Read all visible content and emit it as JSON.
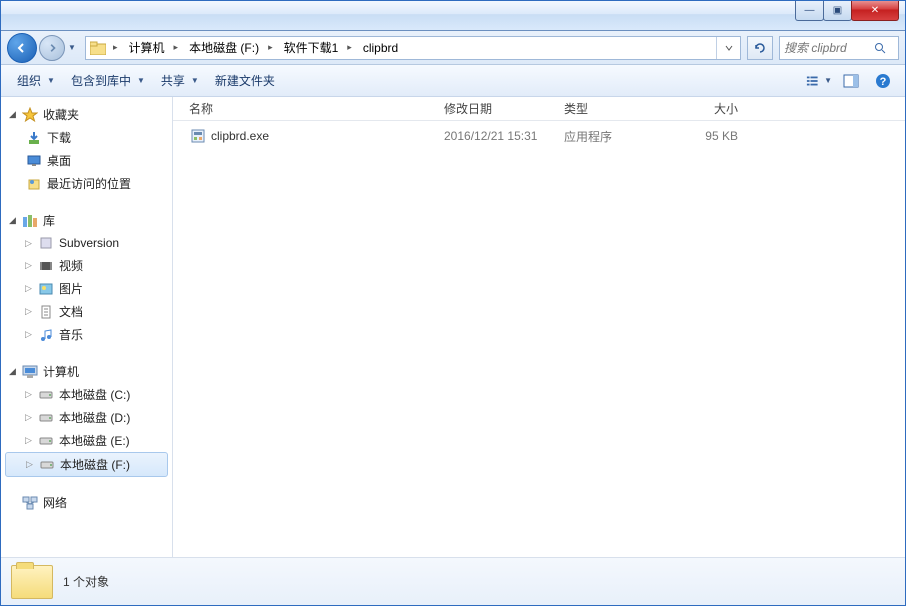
{
  "titlebar": {
    "min": "—",
    "max": "▣",
    "close": "✕"
  },
  "breadcrumb": {
    "segments": [
      "计算机",
      "本地磁盘 (F:)",
      "软件下载1",
      "clipbrd"
    ]
  },
  "search": {
    "placeholder": "搜索 clipbrd"
  },
  "toolbar": {
    "organize": "组织",
    "include": "包含到库中",
    "share": "共享",
    "newfolder": "新建文件夹"
  },
  "sidebar": {
    "favorites": {
      "label": "收藏夹",
      "items": [
        "下载",
        "桌面",
        "最近访问的位置"
      ]
    },
    "libraries": {
      "label": "库",
      "items": [
        "Subversion",
        "视频",
        "图片",
        "文档",
        "音乐"
      ]
    },
    "computer": {
      "label": "计算机",
      "items": [
        "本地磁盘 (C:)",
        "本地磁盘 (D:)",
        "本地磁盘 (E:)",
        "本地磁盘 (F:)"
      ]
    },
    "network": {
      "label": "网络"
    }
  },
  "columns": {
    "name": "名称",
    "date": "修改日期",
    "type": "类型",
    "size": "大小"
  },
  "files": [
    {
      "name": "clipbrd.exe",
      "date": "2016/12/21 15:31",
      "type": "应用程序",
      "size": "95 KB"
    }
  ],
  "status": {
    "text": "1 个对象"
  }
}
